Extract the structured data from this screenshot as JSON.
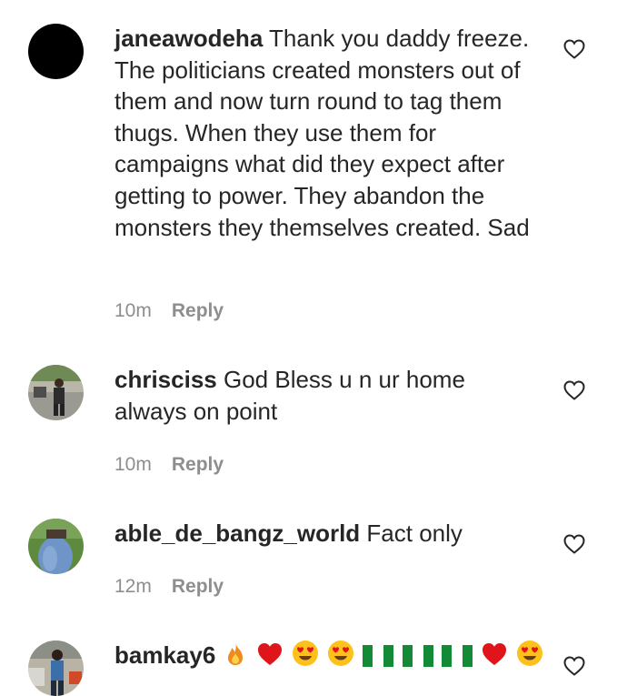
{
  "comments": [
    {
      "username": "janeawodeha",
      "text": "Thank you daddy freeze. The politicians created monsters out of them and now turn round to tag them thugs. When they use them for campaigns what did they expect after getting to power. They abandon the monsters they themselves created. Sad",
      "time": "10m",
      "reply_label": "Reply",
      "avatar": "black-circle-avatar"
    },
    {
      "username": "chrisciss",
      "text": "God Bless u n ur home always on point",
      "time": "10m",
      "reply_label": "Reply",
      "avatar": "photo-avatar"
    },
    {
      "username": "able_de_bangz_world",
      "text": "Fact only",
      "time": "12m",
      "reply_label": "Reply",
      "avatar": "photo-avatar"
    },
    {
      "username": "bamkay6",
      "text": "",
      "emojis": [
        "fire",
        "red-heart",
        "heart-eyes",
        "heart-eyes",
        "nigeria-flag",
        "nigeria-flag",
        "nigeria-flag",
        "red-heart",
        "heart-eyes"
      ],
      "avatar": "photo-avatar"
    }
  ],
  "colors": {
    "text": "#262626",
    "meta": "#8e8e8e",
    "heart_outline": "#262626"
  }
}
